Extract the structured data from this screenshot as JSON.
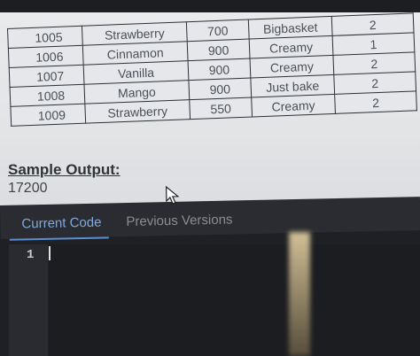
{
  "table": {
    "rows": [
      [
        "1005",
        "Strawberry",
        "700",
        "Bigbasket",
        "2"
      ],
      [
        "1006",
        "Cinnamon",
        "900",
        "Creamy",
        "1"
      ],
      [
        "1007",
        "Vanilla",
        "900",
        "Creamy",
        "2"
      ],
      [
        "1008",
        "Mango",
        "900",
        "Just bake",
        "2"
      ],
      [
        "1009",
        "Strawberry",
        "550",
        "Creamy",
        "2"
      ]
    ]
  },
  "sample": {
    "label": "Sample Output:",
    "value": "17200"
  },
  "editor": {
    "tabs": {
      "current": "Current Code",
      "previous": "Previous Versions"
    },
    "line_numbers": [
      "1"
    ]
  },
  "colors": {
    "active_tab": "#7fa9de",
    "editor_bg": "#1f2024"
  }
}
